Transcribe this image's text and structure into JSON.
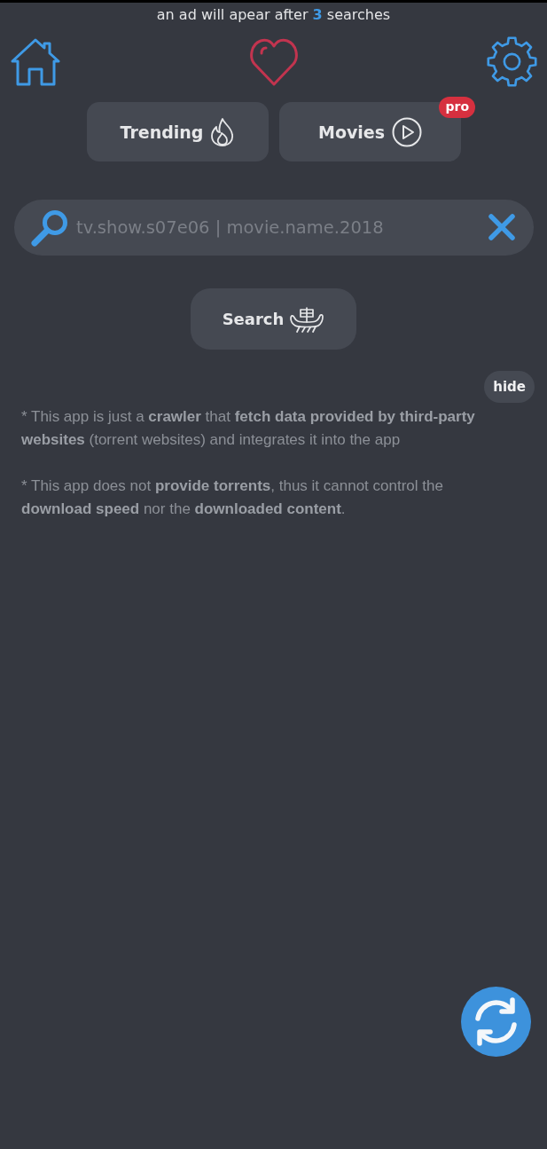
{
  "ad_notice": "an ad will apear after **3** searches",
  "nav_buttons": [
    {
      "label": "Trending",
      "kind": "flame"
    },
    {
      "label": "Movies",
      "kind": "play",
      "badge": "pro"
    }
  ],
  "search": {
    "placeholder": "tv.show.s07e06 | movie.name.2018"
  },
  "search_button": "Search",
  "hide_button": "hide",
  "disclaimers": [
    "* This app is just a **crawler** that **fetch data provided by third-party websites** (torrent websites) and integrates it into the app",
    "* This app does not **provide torrents**, thus it cannot control the **download speed** nor the **downloaded content**."
  ]
}
